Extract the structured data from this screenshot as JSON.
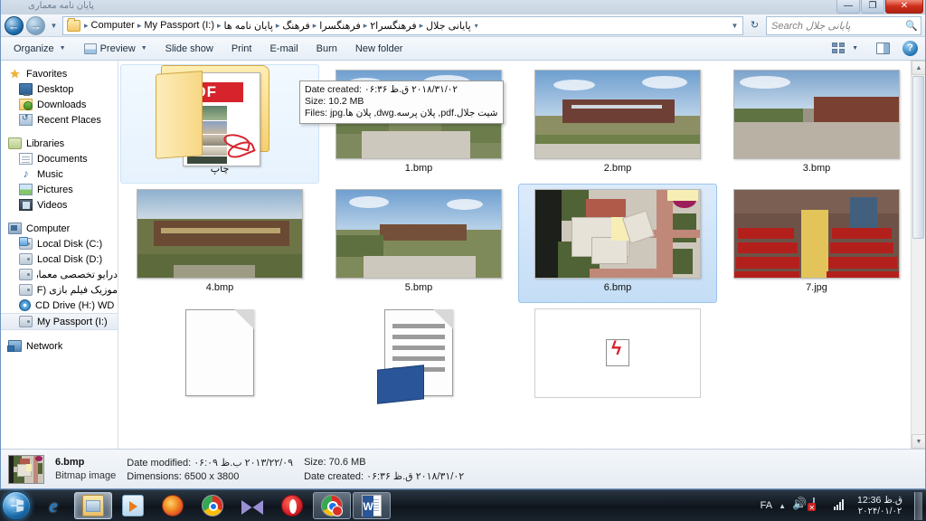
{
  "window": {
    "caption_title": "پایان نامه معماری",
    "minimize": "—",
    "maximize": "❐",
    "close": "✕"
  },
  "address_bar": {
    "back_icon": "←",
    "forward_icon": "→",
    "history_caret": "▼",
    "folder_icon": "folder-icon",
    "crumbs": [
      "Computer",
      "My Passport (I:)",
      "پایان نامه ها",
      "فرهنگ",
      "فرهنگسرا",
      "فرهنگسرا۲",
      "پایانی جلال"
    ],
    "separator": "▸",
    "end_caret": "▾",
    "refresh_icon": "↻",
    "search_placeholder": "Search پایانی جلال",
    "search_value": "",
    "search_icon": "🔍"
  },
  "toolbar": {
    "organize": "Organize",
    "preview": "Preview",
    "slide_show": "Slide show",
    "print": "Print",
    "email": "E-mail",
    "burn": "Burn",
    "new_folder": "New folder",
    "caret": "▼",
    "views_label": "Change your view",
    "preview_pane_label": "Show the preview pane",
    "help_label": "?"
  },
  "navigation_pane": {
    "groups": [
      {
        "header": {
          "label": "Favorites",
          "icon": "star-icon"
        },
        "items": [
          {
            "label": "Desktop",
            "icon": "desktop-icon"
          },
          {
            "label": "Downloads",
            "icon": "downloads-icon"
          },
          {
            "label": "Recent Places",
            "icon": "recent-places-icon"
          }
        ]
      },
      {
        "header": {
          "label": "Libraries",
          "icon": "libraries-icon"
        },
        "items": [
          {
            "label": "Documents",
            "icon": "documents-icon"
          },
          {
            "label": "Music",
            "icon": "music-icon"
          },
          {
            "label": "Pictures",
            "icon": "pictures-icon"
          },
          {
            "label": "Videos",
            "icon": "videos-icon"
          }
        ]
      },
      {
        "header": {
          "label": "Computer",
          "icon": "computer-icon"
        },
        "items": [
          {
            "label": "Local Disk (C:)",
            "icon": "system-drive-icon"
          },
          {
            "label": "Local Disk (D:)",
            "icon": "drive-icon"
          },
          {
            "label": "درایو تخصصی معماری",
            "icon": "drive-icon",
            "rtl": true
          },
          {
            "label": "موزیک فیلم بازی (F:)",
            "icon": "drive-icon",
            "rtl": true
          },
          {
            "label": "CD Drive (H:) WD Un",
            "icon": "cd-drive-icon"
          },
          {
            "label": "My Passport (I:)",
            "icon": "drive-icon",
            "selected": true
          }
        ]
      },
      {
        "header": {
          "label": "Network",
          "icon": "network-icon"
        },
        "items": []
      }
    ]
  },
  "tooltip": {
    "date_created_label": "Date created:",
    "date_created_value": "۲۰۱۸/۳۱/۰۲ ق.ظ ۰۶:۳۶",
    "size_label": "Size:",
    "size_value": "10.2 MB",
    "files_label": "Files:",
    "files_value": "شیت جلال.pdf, پلان پرسه.dwg, پلان ها.jpg"
  },
  "files": [
    {
      "name": "چاپ",
      "type": "folder-pdf",
      "rtl": true,
      "hovered": true
    },
    {
      "name": "1.bmp",
      "type": "render-a"
    },
    {
      "name": "2.bmp",
      "type": "render-b"
    },
    {
      "name": "3.bmp",
      "type": "render-c"
    },
    {
      "name": "4.bmp",
      "type": "render-d"
    },
    {
      "name": "5.bmp",
      "type": "render-e"
    },
    {
      "name": "6.bmp",
      "type": "siteplan",
      "selected": true
    },
    {
      "name": "7.jpg",
      "type": "auditorium"
    },
    {
      "name": "",
      "type": "doc-blank"
    },
    {
      "name": "",
      "type": "doc-word"
    },
    {
      "name": "",
      "type": "doc-pdf"
    }
  ],
  "scrollbar": {
    "up_arrow": "▲",
    "down_arrow": "▼"
  },
  "details_pane": {
    "file_name": "6.bmp",
    "file_type": "Bitmap image",
    "date_modified_label": "Date modified:",
    "date_modified_value": "۲۰۱۳/۲۲/۰۹ ب.ظ ۰۶:۰۹",
    "dimensions_label": "Dimensions:",
    "dimensions_value": "6500 x 3800",
    "size_label": "Size:",
    "size_value": "70.6 MB",
    "date_created_label": "Date created:",
    "date_created_value": "۲۰۱۸/۳۱/۰۲ ق.ظ ۰۶:۳۶"
  },
  "taskbar": {
    "start_label": "Start",
    "buttons": [
      {
        "name": "internet-explorer",
        "icon": "internet-explorer-icon"
      },
      {
        "name": "windows-explorer",
        "icon": "folder-icon",
        "active": true
      },
      {
        "name": "windows-media-player",
        "icon": "media-player-icon"
      },
      {
        "name": "firefox",
        "icon": "firefox-icon"
      },
      {
        "name": "chrome",
        "icon": "chrome-icon"
      },
      {
        "name": "mail",
        "icon": "mail-icon"
      },
      {
        "name": "opera",
        "icon": "opera-icon"
      },
      {
        "name": "chrome-canary",
        "icon": "chrome-icon",
        "grouped": true
      },
      {
        "name": "microsoft-word",
        "icon": "word-icon",
        "grouped": true
      }
    ],
    "tray": {
      "language": "FA",
      "expand_caret": "▲",
      "volume_icon": "speaker-icon",
      "action_center_icon": "flag-icon",
      "network_icon": "network-signal-icon",
      "time": "12:36 ق.ظ",
      "date": "۲۰۲۴/۰۱/۰۲"
    }
  }
}
